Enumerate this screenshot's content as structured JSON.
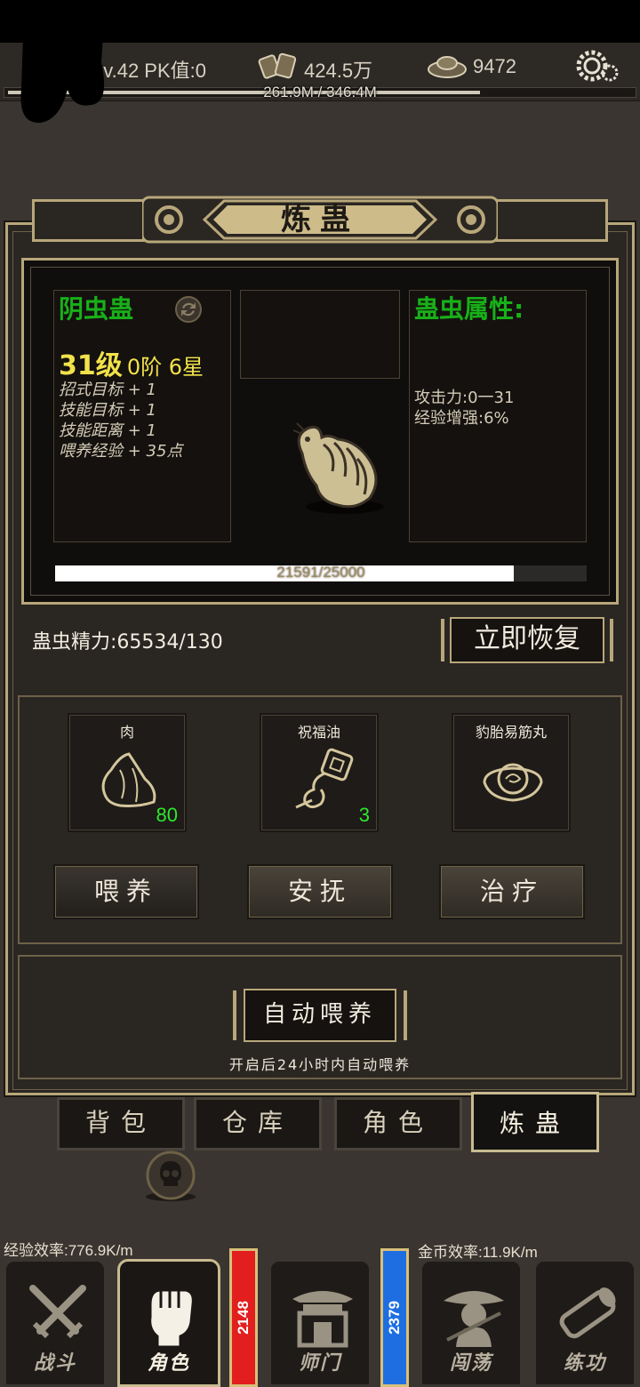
{
  "top_bar": {
    "level_pk": "Lv.42 PK值:0",
    "silver": "424.5万",
    "gold": "9472",
    "exp_progress": "261.9M / 346.4M",
    "exp_fraction": 0.756
  },
  "panel": {
    "title": "炼蛊"
  },
  "gu": {
    "name": "阴虫蛊",
    "level": "31级",
    "stage": "0阶 6星",
    "bonuses": [
      "招式目标 + 1",
      "技能目标 + 1",
      "技能距离 + 1",
      "喂养经验 + 35点"
    ],
    "attr_title": "蛊虫属性:",
    "attrs": [
      "攻击力:0一31",
      "经验增强:6%"
    ],
    "exp_text": "21591/25000",
    "exp_fraction": 0.8636
  },
  "energy": {
    "label": "蛊虫精力:65534/130",
    "restore_label": "立即恢复"
  },
  "items": [
    {
      "name": "肉",
      "count": "80",
      "icon": "meat-icon"
    },
    {
      "name": "祝福油",
      "count": "3",
      "icon": "oil-gourd-icon"
    },
    {
      "name": "豹胎易筋丸",
      "count": "",
      "icon": "pill-bowl-icon"
    }
  ],
  "actions": {
    "feed": "喂养",
    "soothe": "安抚",
    "heal": "治疗"
  },
  "auto": {
    "button": "自动喂养",
    "hint": "开启后24小时内自动喂养"
  },
  "sub_tabs": [
    "背包",
    "仓库",
    "角色",
    "炼蛊"
  ],
  "bottom": {
    "exp_rate": "经验效率:776.9K/m",
    "gold_rate": "金币效率:11.9K/m",
    "nav": [
      "战斗",
      "角色",
      "师门",
      "闯荡",
      "练功"
    ],
    "red_gauge": "2148",
    "blue_gauge": "2379"
  },
  "colors": {
    "accent_gold": "#b8a77a",
    "name_green": "#18b018",
    "level_yellow": "#f2e24a",
    "count_green": "#2ee82e"
  }
}
